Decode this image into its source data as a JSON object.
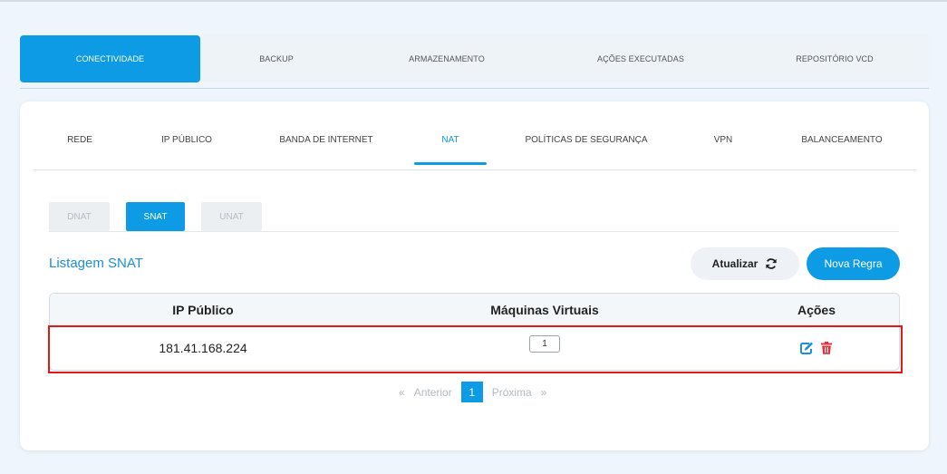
{
  "main_tabs": [
    {
      "label": "CONECTIVIDADE",
      "active": true
    },
    {
      "label": "BACKUP",
      "active": false
    },
    {
      "label": "ARMAZENAMENTO",
      "active": false
    },
    {
      "label": "AÇÕES EXECUTADAS",
      "active": false
    },
    {
      "label": "REPOSITÓRIO VCD",
      "active": false
    }
  ],
  "sub_tabs": [
    {
      "label": "REDE"
    },
    {
      "label": "IP PÚBLICO"
    },
    {
      "label": "BANDA DE INTERNET"
    },
    {
      "label": "NAT"
    },
    {
      "label": "POLÍTICAS DE SEGURANÇA"
    },
    {
      "label": "VPN"
    },
    {
      "label": "BALANCEAMENTO"
    }
  ],
  "nat_types": [
    {
      "label": "DNAT"
    },
    {
      "label": "SNAT"
    },
    {
      "label": "UNAT"
    }
  ],
  "list_title": "Listagem SNAT",
  "buttons": {
    "refresh_label": "Atualizar",
    "new_rule_label": "Nova Regra"
  },
  "table": {
    "headers": [
      "IP Público",
      "Máquinas Virtuais",
      "Ações"
    ],
    "rows": [
      {
        "ip": "181.41.168.224",
        "vms": "1"
      }
    ]
  },
  "pagination": {
    "first": "«",
    "prev": "Anterior",
    "current": "1",
    "next": "Próxima",
    "last": "»"
  },
  "colors": {
    "accent": "#0d9be6",
    "danger": "#e41818",
    "background": "#eef5fc"
  }
}
